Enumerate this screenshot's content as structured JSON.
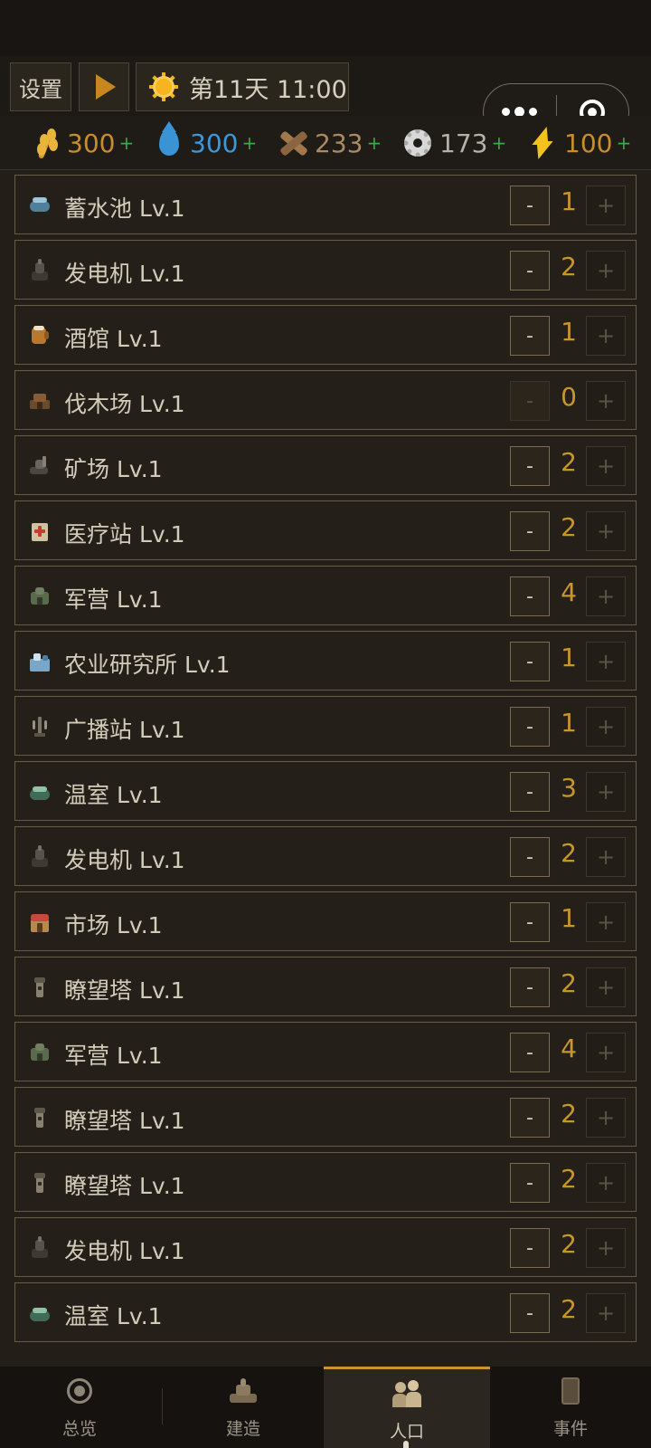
{
  "topbar": {
    "settings_label": "设置",
    "day_text": "第11天 11:00"
  },
  "resources": [
    {
      "icon": "wheat-icon",
      "value": "300",
      "plus": "+",
      "color": "#c98d2c"
    },
    {
      "icon": "water-drop-icon",
      "value": "300",
      "plus": "+",
      "color": "#3c97db"
    },
    {
      "icon": "wood-icon",
      "value": "233",
      "plus": "+",
      "color": "#a98a63"
    },
    {
      "icon": "gear-icon",
      "value": "173",
      "plus": "+",
      "color": "#b7b0a4"
    },
    {
      "icon": "lightning-icon",
      "value": "100",
      "plus": "+",
      "color": "#c98d2c"
    }
  ],
  "buildings": [
    {
      "name": "蓄水池 Lv.1",
      "count": "1",
      "icon": "reservoir-icon"
    },
    {
      "name": "发电机 Lv.1",
      "count": "2",
      "icon": "generator-icon"
    },
    {
      "name": "酒馆 Lv.1",
      "count": "1",
      "icon": "tavern-icon"
    },
    {
      "name": "伐木场 Lv.1",
      "count": "0",
      "icon": "lumberyard-icon",
      "minus_disabled": true
    },
    {
      "name": "矿场 Lv.1",
      "count": "2",
      "icon": "mine-icon"
    },
    {
      "name": "医疗站 Lv.1",
      "count": "2",
      "icon": "clinic-icon"
    },
    {
      "name": "军营 Lv.1",
      "count": "4",
      "icon": "barracks-icon"
    },
    {
      "name": "农业研究所 Lv.1",
      "count": "1",
      "icon": "research-lab-icon"
    },
    {
      "name": "广播站 Lv.1",
      "count": "1",
      "icon": "radio-tower-icon"
    },
    {
      "name": "温室 Lv.1",
      "count": "3",
      "icon": "greenhouse-icon"
    },
    {
      "name": "发电机 Lv.1",
      "count": "2",
      "icon": "generator-icon"
    },
    {
      "name": "市场 Lv.1",
      "count": "1",
      "icon": "market-icon"
    },
    {
      "name": "瞭望塔 Lv.1",
      "count": "2",
      "icon": "watchtower-icon"
    },
    {
      "name": "军营 Lv.1",
      "count": "4",
      "icon": "barracks-icon"
    },
    {
      "name": "瞭望塔 Lv.1",
      "count": "2",
      "icon": "watchtower-icon"
    },
    {
      "name": "瞭望塔 Lv.1",
      "count": "2",
      "icon": "watchtower-icon"
    },
    {
      "name": "发电机 Lv.1",
      "count": "2",
      "icon": "generator-icon"
    },
    {
      "name": "温室 Lv.1",
      "count": "2",
      "icon": "greenhouse-icon"
    }
  ],
  "controls": {
    "minus": "-",
    "plus": "+"
  },
  "nav": [
    {
      "label": "总览",
      "icon": "overview-icon"
    },
    {
      "label": "建造",
      "icon": "build-icon"
    },
    {
      "label": "人口",
      "icon": "population-icon",
      "active": true
    },
    {
      "label": "事件",
      "icon": "events-icon"
    }
  ]
}
